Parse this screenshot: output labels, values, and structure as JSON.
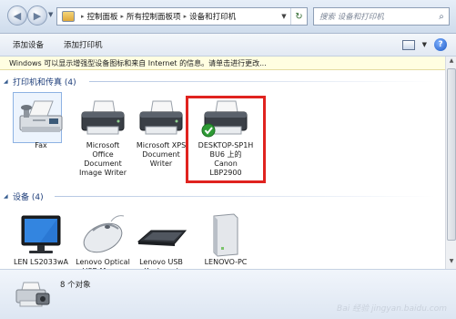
{
  "navigation": {
    "breadcrumbs": [
      "控制面板",
      "所有控制面板项",
      "设备和打印机"
    ],
    "search_placeholder": "搜索 设备和打印机"
  },
  "toolbar": {
    "add_device": "添加设备",
    "add_printer": "添加打印机"
  },
  "infobar": {
    "message": "Windows 可以显示增强型设备图标和来自 Internet 的信息。请单击进行更改..."
  },
  "groups": {
    "printers": {
      "title": "打印机和传真 (4)",
      "items": [
        {
          "label": "Fax",
          "icon": "fax-icon"
        },
        {
          "label": "Microsoft Office Document Image Writer",
          "icon": "printer-icon"
        },
        {
          "label": "Microsoft XPS Document Writer",
          "icon": "printer-icon"
        },
        {
          "label": "DESKTOP-SP1H BU6 上的 Canon LBP2900",
          "icon": "printer-default-icon"
        }
      ]
    },
    "devices": {
      "title": "设备 (4)",
      "items": [
        {
          "label": "LEN LS2033wA",
          "icon": "monitor-icon"
        },
        {
          "label": "Lenovo Optical USB Mouse",
          "icon": "mouse-icon"
        },
        {
          "label": "Lenovo USB Keyboard",
          "icon": "keyboard-icon"
        },
        {
          "label": "LENOVO-PC",
          "icon": "computer-tower-icon"
        }
      ]
    }
  },
  "status": {
    "text": "8 个对象"
  },
  "watermark": "Bai 经验 jingyan.baidu.com",
  "colors": {
    "highlight": "#e0231f",
    "group_title": "#1e3e7a",
    "infobar_bg": "#fffee1"
  }
}
